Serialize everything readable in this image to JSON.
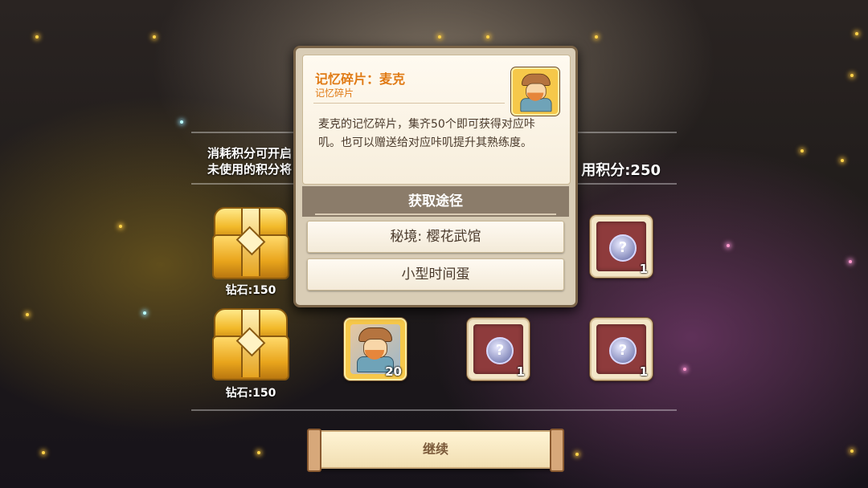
{
  "info": {
    "line1": "消耗积分可开启",
    "line2": "未使用的积分将",
    "points_text": "用积分:250"
  },
  "chests": [
    {
      "cost": "钻石:150"
    },
    {
      "cost": "钻石:150"
    }
  ],
  "slots": {
    "row1_right_count": "1",
    "row2_item_count": "20",
    "row2_mid_count": "1",
    "row2_right_count": "1",
    "unknown_symbol": "?"
  },
  "popup": {
    "title": "记忆碎片：麦克",
    "subtitle": "记忆碎片",
    "description": "麦克的记忆碎片，集齐50个即可获得对应咔叽。也可以赠送给对应咔叽提升其熟练度。",
    "source_header": "获取途径",
    "sources": [
      "秘境: 樱花武馆",
      "小型时间蛋"
    ]
  },
  "continue_label": "继续",
  "colors": {
    "title_orange": "#e07a14",
    "slot_red": "#8e3b3c",
    "gold": "#f6c84a"
  }
}
